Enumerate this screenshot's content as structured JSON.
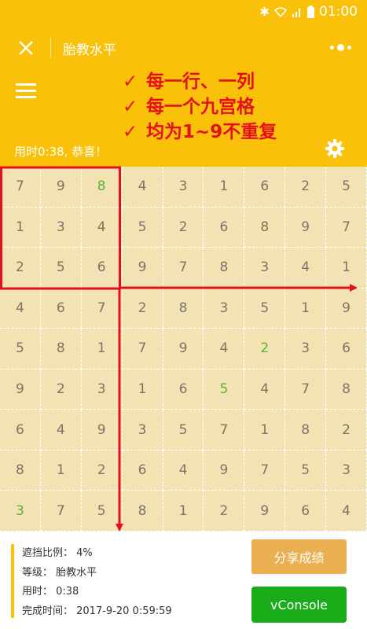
{
  "status_bar": {
    "icons": [
      "bluetooth-icon",
      "wifi-icon",
      "signal-icon",
      "battery-icon"
    ],
    "time": "01:00"
  },
  "nav": {
    "title": "胎教水平"
  },
  "header": {
    "rules": [
      "每一行、一列",
      "每一个九宫格",
      "均为1~9不重复"
    ],
    "check_mark": "✓",
    "timer_text": "用时0:38, 恭喜！"
  },
  "board": {
    "rows": [
      [
        7,
        9,
        8,
        4,
        3,
        1,
        6,
        2,
        5
      ],
      [
        1,
        3,
        4,
        5,
        2,
        6,
        8,
        9,
        7
      ],
      [
        2,
        5,
        6,
        9,
        7,
        8,
        3,
        4,
        1
      ],
      [
        4,
        6,
        7,
        2,
        8,
        3,
        5,
        1,
        9
      ],
      [
        5,
        8,
        1,
        7,
        9,
        4,
        2,
        3,
        6
      ],
      [
        9,
        2,
        3,
        1,
        6,
        5,
        4,
        7,
        8
      ],
      [
        6,
        4,
        9,
        3,
        5,
        7,
        1,
        8,
        2
      ],
      [
        8,
        1,
        2,
        6,
        4,
        9,
        7,
        5,
        3
      ],
      [
        3,
        7,
        5,
        8,
        1,
        2,
        9,
        6,
        4
      ]
    ],
    "highlighted": [
      [
        0,
        2
      ],
      [
        4,
        6
      ],
      [
        5,
        5
      ],
      [
        8,
        0
      ]
    ]
  },
  "footer": {
    "mask_ratio": "遮挡比例： 4%",
    "level": "等级： 胎教水平",
    "time_used": "用时： 0:38",
    "finish_time": "完成时间： 2017-9-20 0:59:59",
    "share_label": "分享成绩",
    "vconsole_label": "vConsole"
  },
  "colors": {
    "theme": "#f9c10a",
    "annotation": "#e4111a",
    "board_bg": "#f3e2b4",
    "hint_digit": "#5bb231",
    "share_button": "#e9af50",
    "vconsole_button": "#1aad19"
  }
}
